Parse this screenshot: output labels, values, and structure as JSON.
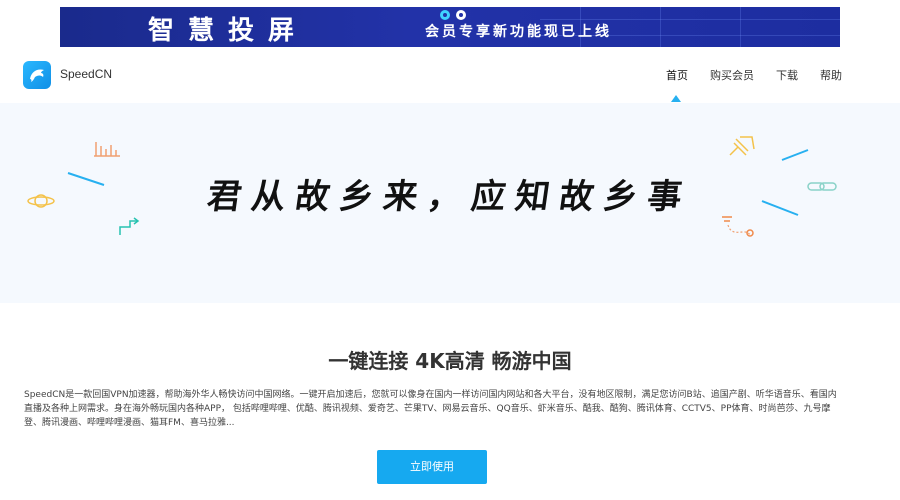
{
  "promo": {
    "title": "智慧投屏",
    "subtitle": "会员专享新功能现已上线",
    "colors": {
      "bg": "#1d2da0",
      "accent": "#3fd2ff"
    }
  },
  "header": {
    "logo_icon": "dolphin-logo-icon",
    "brand": "SpeedCN",
    "nav": [
      {
        "label": "首页",
        "active": true
      },
      {
        "label": "购买会员",
        "active": false
      },
      {
        "label": "下载",
        "active": false
      },
      {
        "label": "帮助",
        "active": false
      }
    ]
  },
  "hero": {
    "poem": "君从故乡来，应知故乡事"
  },
  "main": {
    "headline": "一键连接 4K高清 畅游中国",
    "description": "SpeedCN是一款回国VPN加速器，帮助海外华人畅快访问中国网络。一键开启加速后，您就可以像身在国内一样访问国内网站和各大平台，没有地区限制，满足您访问B站、追国产剧、听华语音乐、看国内直播及各种上网需求。身在海外畅玩国内各种APP， 包括哔哩哔哩、优酷、腾讯视频、爱奇艺、芒果TV、网易云音乐、QQ音乐、虾米音乐、酷我、酷狗、腾讯体育、CCTV5、PP体育、时尚芭莎、九号摩登、腾讯漫画、哔哩哔哩漫画、猫耳FM、喜马拉雅...",
    "cta_label": "立即使用"
  },
  "colors": {
    "primary": "#16a9f0",
    "hero_bg": "#f5f9fe"
  }
}
